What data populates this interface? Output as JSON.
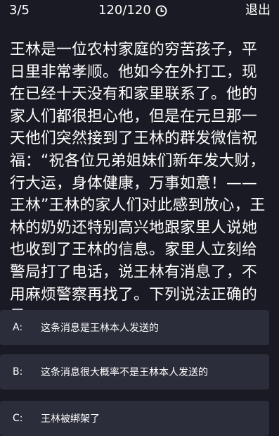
{
  "header": {
    "progress": "3/5",
    "timer": "120/120",
    "timer_icon": "clock-icon",
    "quit_label": "退出"
  },
  "question": {
    "text": "王林是一位农村家庭的穷苦孩子，平日里非常孝顺。他如今在外打工，现在已经十天没有和家里联系了。他的家人们都很担心他，但是在元旦那一天他们突然接到了王林的群发微信祝福：“祝各位兄弟姐妹们新年发大财，行大运，身体健康，万事如意！——王林”王林的家人们对此感到放心，王林的奶奶还特别高兴地跟家里人说她也收到了王林的信息。家里人立刻给警局打了电话，说王林有消息了，不用麻烦警察再找了。下列说法正确的是："
  },
  "options": [
    {
      "letter": "A:",
      "text": "这条消息是王林本人发送的"
    },
    {
      "letter": "B:",
      "text": "这条消息很大概率不是王林本人发送的"
    },
    {
      "letter": "C:",
      "text": "王林被绑架了"
    }
  ]
}
